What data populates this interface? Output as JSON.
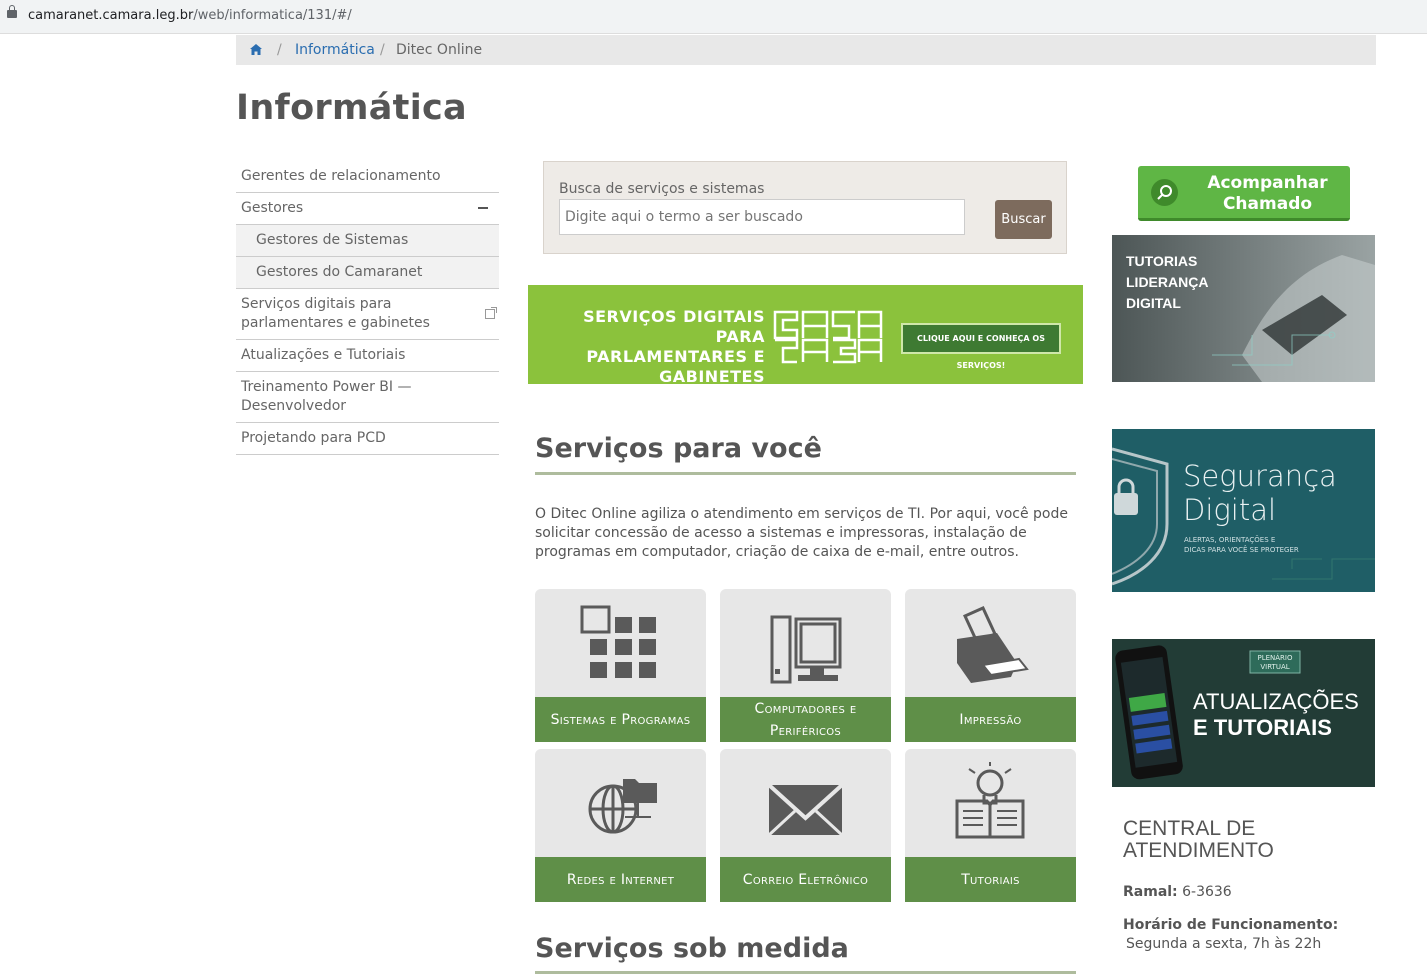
{
  "browser": {
    "url_host": "camaranet.camara.leg.br",
    "url_path": "/web/informatica/131/#/"
  },
  "breadcrumb": {
    "items": [
      "Informática",
      "Ditec Online"
    ]
  },
  "page_title": "Informática",
  "sidebar": {
    "items": [
      "Gerentes de relacionamento",
      "Gestores",
      "Gestores de Sistemas",
      "Gestores do Camaranet",
      "Serviços digitais para parlamentares e gabinetes",
      "Atualizações e Tutoriais",
      "Treinamento Power BI — Desenvolvedor",
      "Projetando para PCD"
    ]
  },
  "search": {
    "label": "Busca de serviços e sistemas",
    "placeholder": "Digite aqui o termo a ser buscado",
    "button": "Buscar"
  },
  "banner": {
    "line1": "SERVIÇOS DIGITAIS PARA",
    "line2": "PARLAMENTARES E",
    "line3": "GABINETES",
    "cta": "CLIQUE AQUI E CONHEÇA OS SERVIÇOS!"
  },
  "services": {
    "title": "Serviços para você",
    "intro": "O Ditec Online agiliza o atendimento em serviços de TI. Por aqui, você pode solicitar concessão de acesso a sistemas e impressoras, instalação de programas em computador, criação de caixa de e-mail, entre outros.",
    "cards": [
      "Sistemas e Programas",
      "Computadores e Periféricos",
      "Impressão",
      "Redes e Internet",
      "Correio Eletrônico",
      "Tutoriais"
    ]
  },
  "custom_services": {
    "title": "Serviços sob medida"
  },
  "right": {
    "track_button": "Acompanhar Chamado",
    "tile1": {
      "line1": "TUTORIAS",
      "line2": "LIDERANÇA",
      "line3": "DIGITAL"
    },
    "tile2": {
      "title1": "Segurança",
      "title2": "Digital",
      "sub1": "ALERTAS, ORIENTAÇÕES E",
      "sub2": "DICAS PARA VOCÊ SE PROTEGER"
    },
    "tile3": {
      "badge1": "PLENÁRIO",
      "badge2": "VIRTUAL",
      "line1": "ATUALIZAÇÕES",
      "line2": "E TUTORIAIS"
    }
  },
  "central": {
    "title1": "CENTRAL DE",
    "title2": "ATENDIMENTO",
    "ramal_label": "Ramal:",
    "ramal_value": "6-3636",
    "hours_label": "Horário de Funcionamento:",
    "hours_value": "Segunda a sexta, 7h às 22h"
  }
}
